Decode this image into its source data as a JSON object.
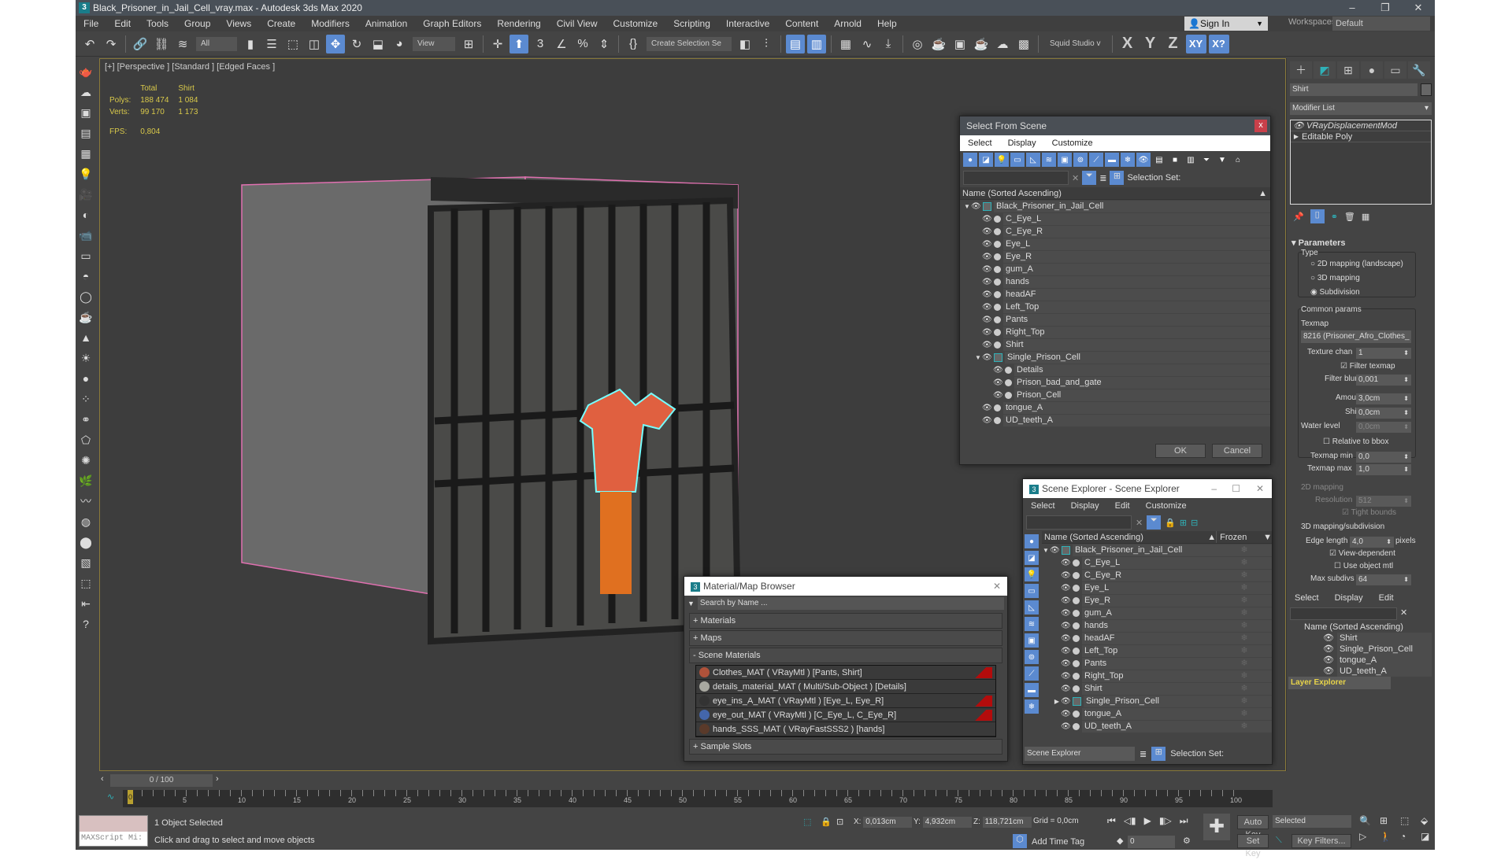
{
  "window": {
    "title": "Black_Prisoner_in_Jail_Cell_vray.max - Autodesk 3ds Max 2020",
    "controls": [
      "–",
      "❐",
      "✕"
    ]
  },
  "menu": [
    "File",
    "Edit",
    "Tools",
    "Group",
    "Views",
    "Create",
    "Modifiers",
    "Animation",
    "Graph Editors",
    "Rendering",
    "Civil View",
    "Customize",
    "Scripting",
    "Interactive",
    "Content",
    "Arnold",
    "Help"
  ],
  "signin": {
    "label": "Sign In"
  },
  "workspaces": {
    "label": "Workspaces:",
    "value": "Default"
  },
  "toolbar": {
    "filter_select": "All",
    "ref_coord": "View",
    "selection_set": "Create Selection Se",
    "studio": "Squid Studio v",
    "axes": [
      "X",
      "Y",
      "Z"
    ],
    "axis_xy": "XY",
    "axis_xp": "X?"
  },
  "viewport": {
    "label": "[+] [Perspective ] [Standard ] [Edged Faces ]",
    "stats": {
      "headers": [
        "",
        "Total",
        "Shirt"
      ],
      "rows": [
        [
          "Polys:",
          "188 474",
          "1 084"
        ],
        [
          "Verts:",
          "99 170",
          "1 173"
        ]
      ],
      "fps_label": "FPS:",
      "fps": "0,804"
    }
  },
  "select_from_scene": {
    "title": "Select From Scene",
    "menu": [
      "Select",
      "Display",
      "Customize"
    ],
    "selection_set_label": "Selection Set:",
    "column": "Name (Sorted Ascending)",
    "tree": [
      {
        "name": "Black_Prisoner_in_Jail_Cell",
        "level": 0,
        "group": true,
        "expanded": true
      },
      {
        "name": "C_Eye_L",
        "level": 1
      },
      {
        "name": "C_Eye_R",
        "level": 1
      },
      {
        "name": "Eye_L",
        "level": 1
      },
      {
        "name": "Eye_R",
        "level": 1
      },
      {
        "name": "gum_A",
        "level": 1
      },
      {
        "name": "hands",
        "level": 1
      },
      {
        "name": "headAF",
        "level": 1
      },
      {
        "name": "Left_Top",
        "level": 1
      },
      {
        "name": "Pants",
        "level": 1
      },
      {
        "name": "Right_Top",
        "level": 1
      },
      {
        "name": "Shirt",
        "level": 1
      },
      {
        "name": "Single_Prison_Cell",
        "level": 1,
        "group": true,
        "expanded": true
      },
      {
        "name": "Details",
        "level": 2
      },
      {
        "name": "Prison_bad_and_gate",
        "level": 2
      },
      {
        "name": "Prison_Cell",
        "level": 2
      },
      {
        "name": "tongue_A",
        "level": 1
      },
      {
        "name": "UD_teeth_A",
        "level": 1
      }
    ],
    "ok": "OK",
    "cancel": "Cancel"
  },
  "scene_explorer": {
    "title": "Scene Explorer - Scene Explorer",
    "menu": [
      "Select",
      "Display",
      "Edit",
      "Customize"
    ],
    "column": "Name (Sorted Ascending)",
    "column2": "Frozen",
    "tree": [
      {
        "name": "Black_Prisoner_in_Jail_Cell",
        "level": 0,
        "group": true,
        "expanded": true
      },
      {
        "name": "C_Eye_L",
        "level": 1
      },
      {
        "name": "C_Eye_R",
        "level": 1
      },
      {
        "name": "Eye_L",
        "level": 1
      },
      {
        "name": "Eye_R",
        "level": 1
      },
      {
        "name": "gum_A",
        "level": 1
      },
      {
        "name": "hands",
        "level": 1
      },
      {
        "name": "headAF",
        "level": 1
      },
      {
        "name": "Left_Top",
        "level": 1
      },
      {
        "name": "Pants",
        "level": 1
      },
      {
        "name": "Right_Top",
        "level": 1
      },
      {
        "name": "Shirt",
        "level": 1
      },
      {
        "name": "Single_Prison_Cell",
        "level": 1,
        "group": true,
        "expanded": false
      },
      {
        "name": "tongue_A",
        "level": 1
      },
      {
        "name": "UD_teeth_A",
        "level": 1
      }
    ],
    "explorer_select": "Scene Explorer",
    "selection_set_label": "Selection Set:"
  },
  "material_browser": {
    "title": "Material/Map Browser",
    "search_placeholder": "Search by Name ...",
    "sections": {
      "materials": "+ Materials",
      "maps": "+ Maps",
      "scene": "- Scene Materials",
      "slots": "+ Sample Slots"
    },
    "scene_materials": [
      {
        "name": "Clothes_MAT ( VRayMtl ) [Pants, Shirt]",
        "swatch": "#b0523a",
        "flag": true
      },
      {
        "name": "details_material_MAT ( Multi/Sub-Object ) [Details]",
        "swatch": "#a8a8a0",
        "flag": false
      },
      {
        "name": "eye_ins_A_MAT ( VRayMtl ) [Eye_L, Eye_R]",
        "swatch": "#333333",
        "flag": true
      },
      {
        "name": "eye_out_MAT ( VRayMtl ) [C_Eye_L, C_Eye_R]",
        "swatch": "#4466aa",
        "flag": true
      },
      {
        "name": "hands_SSS_MAT ( VRayFastSSS2 ) [hands]",
        "swatch": "#5a3a2a",
        "flag": false
      }
    ]
  },
  "command_panel": {
    "object_name": "Shirt",
    "modifier_list": "Modifier List",
    "stack": [
      "VRayDisplacementMod",
      "Editable Poly"
    ],
    "rollout": "Parameters",
    "type_label": "Type",
    "types": [
      {
        "label": "2D mapping (landscape)",
        "checked": false
      },
      {
        "label": "3D mapping",
        "checked": false
      },
      {
        "label": "Subdivision",
        "checked": true
      }
    ],
    "common_params": "Common params",
    "texmap_label": "Texmap",
    "texmap_value": "8216 (Prisoner_Afro_Clothes_",
    "texture_chan_label": "Texture chan",
    "texture_chan": "1",
    "filter_texmap": "Filter texmap",
    "filter_blur_label": "Filter blur",
    "filter_blur": "0,001",
    "amount_label": "Amount",
    "amount": "3,0cm",
    "shift_label": "Shift",
    "shift": "0,0cm",
    "water_label": "Water level",
    "water": "0,0cm",
    "relative_bbox": "Relative to bbox",
    "texmap_min_label": "Texmap min",
    "texmap_min": "0,0",
    "texmap_max_label": "Texmap max",
    "texmap_max": "1,0",
    "map2d_label": "2D mapping",
    "resolution_label": "Resolution",
    "resolution": "512",
    "tight_bounds": "Tight bounds",
    "map3d_label": "3D mapping/subdivision",
    "edge_length_label": "Edge length",
    "edge_length": "4,0",
    "pixels": "pixels",
    "view_dependent": "View-dependent",
    "use_object_mtl": "Use object mtl",
    "max_subdivs_label": "Max subdivs",
    "max_subdivs": "64",
    "layer_menu": [
      "Select",
      "Display",
      "Edit"
    ],
    "layer_column": "Name (Sorted Ascending)",
    "layer_items": [
      "Shirt",
      "Single_Prison_Cell",
      "tongue_A",
      "UD_teeth_A"
    ],
    "layer_explorer": "Layer Explorer"
  },
  "timeline": {
    "frame": "0 / 100",
    "ticks": [
      0,
      5,
      10,
      15,
      20,
      25,
      30,
      35,
      40,
      45,
      50,
      55,
      60,
      65,
      70,
      75,
      80,
      85,
      90,
      95,
      100
    ]
  },
  "status": {
    "maxscript": "MAXScript Mi:",
    "selected": "1 Object Selected",
    "prompt": "Click and drag to select and move objects",
    "x": "0,013cm",
    "y": "4,932cm",
    "z": "118,721cm",
    "grid": "Grid = 0,0cm",
    "add_time_tag": "Add Time Tag",
    "current_frame": "0",
    "auto_key": "Auto Key",
    "set_key": "Set Key",
    "key_mode": "Selected",
    "key_filters": "Key Filters..."
  }
}
